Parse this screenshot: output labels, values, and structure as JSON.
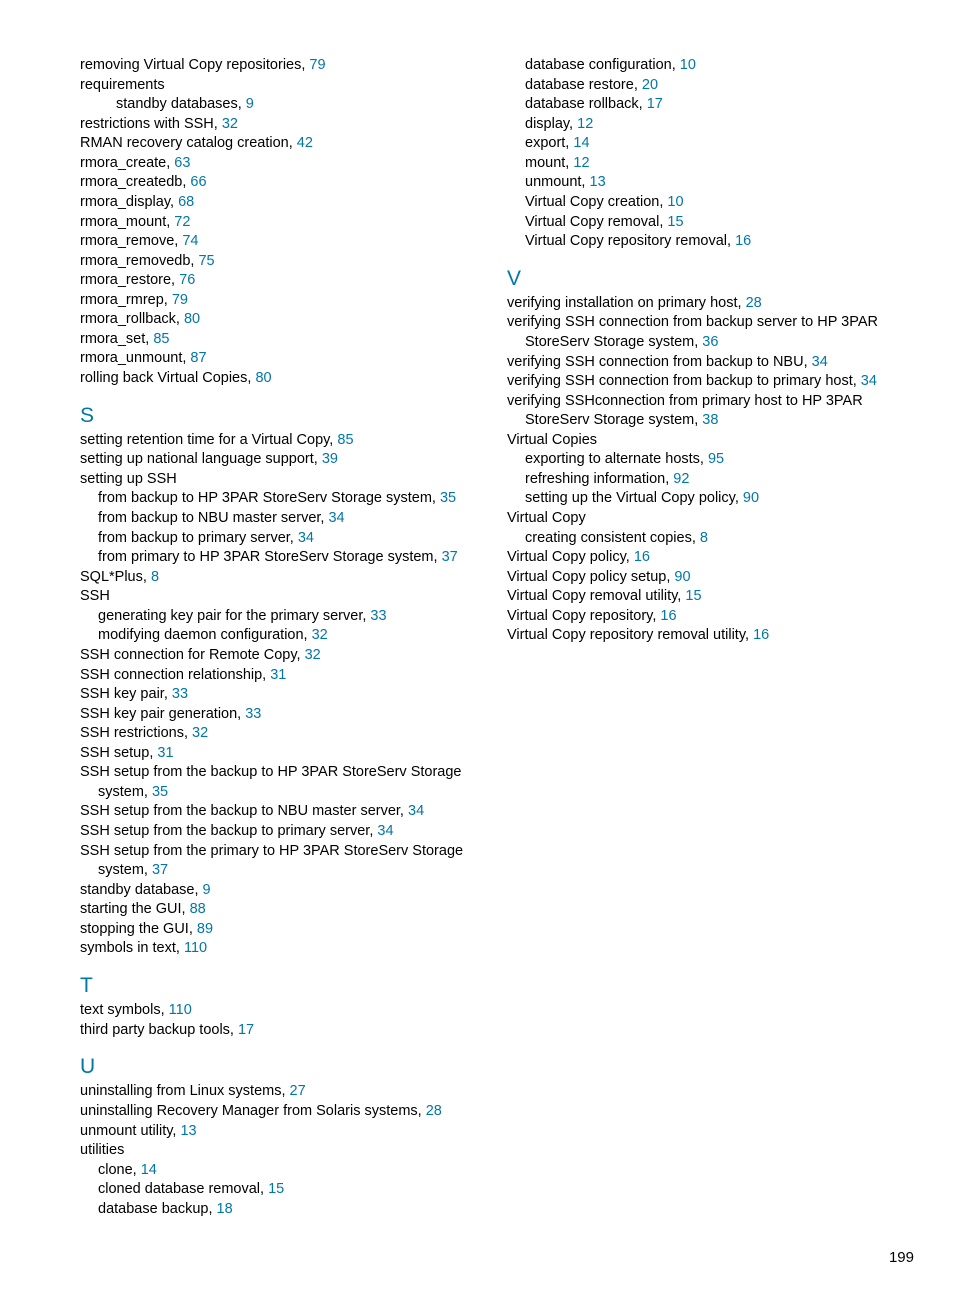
{
  "page_number": "199",
  "left": [
    {
      "t": "e",
      "i": 0,
      "text": "removing Virtual Copy repositories,",
      "pg": "79"
    },
    {
      "t": "e",
      "i": 0,
      "text": "requirements"
    },
    {
      "t": "e",
      "i": 2,
      "text": "standby databases,",
      "pg": "9"
    },
    {
      "t": "e",
      "i": 0,
      "text": "restrictions with SSH,",
      "pg": "32"
    },
    {
      "t": "e",
      "i": 0,
      "text": "RMAN recovery catalog creation,",
      "pg": "42"
    },
    {
      "t": "e",
      "i": 0,
      "text": "rmora_create,",
      "pg": "63"
    },
    {
      "t": "e",
      "i": 0,
      "text": "rmora_createdb,",
      "pg": "66"
    },
    {
      "t": "e",
      "i": 0,
      "text": "rmora_display,",
      "pg": "68"
    },
    {
      "t": "e",
      "i": 0,
      "text": "rmora_mount,",
      "pg": "72"
    },
    {
      "t": "e",
      "i": 0,
      "text": "rmora_remove,",
      "pg": "74"
    },
    {
      "t": "e",
      "i": 0,
      "text": "rmora_removedb,",
      "pg": "75"
    },
    {
      "t": "e",
      "i": 0,
      "text": "rmora_restore,",
      "pg": "76"
    },
    {
      "t": "e",
      "i": 0,
      "text": "rmora_rmrep,",
      "pg": "79"
    },
    {
      "t": "e",
      "i": 0,
      "text": "rmora_rollback,",
      "pg": "80"
    },
    {
      "t": "e",
      "i": 0,
      "text": "rmora_set,",
      "pg": "85"
    },
    {
      "t": "e",
      "i": 0,
      "text": "rmora_unmount,",
      "pg": "87"
    },
    {
      "t": "e",
      "i": 0,
      "text": "rolling back Virtual Copies,",
      "pg": "80"
    },
    {
      "t": "h",
      "text": "S"
    },
    {
      "t": "e",
      "i": 0,
      "text": "setting retention time for a Virtual Copy,",
      "pg": "85"
    },
    {
      "t": "e",
      "i": 0,
      "text": "setting up national language support,",
      "pg": "39"
    },
    {
      "t": "e",
      "i": 0,
      "text": "setting up SSH"
    },
    {
      "t": "e",
      "i": 1,
      "text": "from backup to HP 3PAR StoreServ Storage system,",
      "pg": "35"
    },
    {
      "t": "e",
      "i": 1,
      "text": "from backup to NBU master server,",
      "pg": "34"
    },
    {
      "t": "e",
      "i": 1,
      "text": "from backup to primary server,",
      "pg": "34"
    },
    {
      "t": "e",
      "i": 1,
      "text": "from primary to HP 3PAR StoreServ Storage system,",
      "pg": "37"
    },
    {
      "t": "e",
      "i": 0,
      "text": "SQL*Plus,",
      "pg": "8"
    },
    {
      "t": "e",
      "i": 0,
      "text": "SSH"
    },
    {
      "t": "e",
      "i": 1,
      "text": "generating key pair for the primary server,",
      "pg": "33"
    },
    {
      "t": "e",
      "i": 1,
      "text": "modifying daemon configuration,",
      "pg": "32"
    },
    {
      "t": "e",
      "i": 0,
      "text": "SSH connection for Remote Copy,",
      "pg": "32"
    },
    {
      "t": "e",
      "i": 0,
      "text": "SSH connection relationship,",
      "pg": "31"
    },
    {
      "t": "e",
      "i": 0,
      "text": "SSH key pair,",
      "pg": "33"
    },
    {
      "t": "e",
      "i": 0,
      "text": "SSH key pair generation,",
      "pg": "33"
    },
    {
      "t": "e",
      "i": 0,
      "text": "SSH restrictions,",
      "pg": "32"
    },
    {
      "t": "e",
      "i": 0,
      "text": "SSH setup,",
      "pg": "31"
    },
    {
      "t": "w",
      "i": 0,
      "text": "SSH setup from the backup to HP 3PAR StoreServ Storage system,",
      "pg": "35"
    },
    {
      "t": "e",
      "i": 0,
      "text": "SSH setup from the backup to NBU master server,",
      "pg": "34"
    },
    {
      "t": "e",
      "i": 0,
      "text": "SSH setup from the backup to primary server,",
      "pg": "34"
    },
    {
      "t": "w",
      "i": 0,
      "text": "SSH setup from the primary to HP 3PAR StoreServ Storage system,",
      "pg": "37"
    },
    {
      "t": "e",
      "i": 0,
      "text": "standby database,",
      "pg": "9"
    },
    {
      "t": "e",
      "i": 0,
      "text": "starting the GUI,",
      "pg": "88"
    },
    {
      "t": "e",
      "i": 0,
      "text": "stopping the GUI,",
      "pg": "89"
    },
    {
      "t": "e",
      "i": 0,
      "text": "symbols in text,",
      "pg": "110"
    },
    {
      "t": "h",
      "text": "T"
    },
    {
      "t": "e",
      "i": 0,
      "text": "text symbols,",
      "pg": "110"
    },
    {
      "t": "e",
      "i": 0,
      "text": "third party backup tools,",
      "pg": "17"
    },
    {
      "t": "h",
      "text": "U"
    },
    {
      "t": "e",
      "i": 0,
      "text": "uninstalling from Linux systems,",
      "pg": "27"
    },
    {
      "t": "e",
      "i": 0,
      "text": "uninstalling Recovery Manager from Solaris systems,",
      "pg": "28"
    },
    {
      "t": "e",
      "i": 0,
      "text": "unmount utility,",
      "pg": "13"
    },
    {
      "t": "e",
      "i": 0,
      "text": "utilities"
    },
    {
      "t": "e",
      "i": 1,
      "text": "clone,",
      "pg": "14"
    },
    {
      "t": "e",
      "i": 1,
      "text": "cloned database removal,",
      "pg": "15"
    },
    {
      "t": "e",
      "i": 1,
      "text": "database backup,",
      "pg": "18"
    }
  ],
  "right": [
    {
      "t": "e",
      "i": 1,
      "text": "database configuration,",
      "pg": "10"
    },
    {
      "t": "e",
      "i": 1,
      "text": "database restore,",
      "pg": "20"
    },
    {
      "t": "e",
      "i": 1,
      "text": "database rollback,",
      "pg": "17"
    },
    {
      "t": "e",
      "i": 1,
      "text": "display,",
      "pg": "12"
    },
    {
      "t": "e",
      "i": 1,
      "text": "export,",
      "pg": "14"
    },
    {
      "t": "e",
      "i": 1,
      "text": "mount,",
      "pg": "12"
    },
    {
      "t": "e",
      "i": 1,
      "text": "unmount,",
      "pg": "13"
    },
    {
      "t": "e",
      "i": 1,
      "text": "Virtual Copy creation,",
      "pg": "10"
    },
    {
      "t": "e",
      "i": 1,
      "text": "Virtual Copy removal,",
      "pg": "15"
    },
    {
      "t": "e",
      "i": 1,
      "text": "Virtual Copy repository removal,",
      "pg": "16"
    },
    {
      "t": "h",
      "text": "V"
    },
    {
      "t": "e",
      "i": 0,
      "text": "verifying installation on primary host,",
      "pg": "28"
    },
    {
      "t": "w",
      "i": 0,
      "text": "verifying SSH connection from backup server to HP 3PAR StoreServ Storage system,",
      "pg": "36"
    },
    {
      "t": "e",
      "i": 0,
      "text": "verifying SSH connection from backup to NBU,",
      "pg": "34"
    },
    {
      "t": "e",
      "i": 0,
      "text": "verifying SSH connection from backup to primary host,",
      "pg": "34"
    },
    {
      "t": "w",
      "i": 0,
      "text": "verifying SSHconnection from primary host to HP 3PAR StoreServ Storage system,",
      "pg": "38"
    },
    {
      "t": "e",
      "i": 0,
      "text": "Virtual Copies"
    },
    {
      "t": "e",
      "i": 1,
      "text": "exporting to alternate hosts,",
      "pg": "95"
    },
    {
      "t": "e",
      "i": 1,
      "text": "refreshing information,",
      "pg": "92"
    },
    {
      "t": "e",
      "i": 1,
      "text": "setting up the Virtual Copy policy,",
      "pg": "90"
    },
    {
      "t": "e",
      "i": 0,
      "text": "Virtual Copy"
    },
    {
      "t": "e",
      "i": 1,
      "text": "creating consistent copies,",
      "pg": "8"
    },
    {
      "t": "e",
      "i": 0,
      "text": "Virtual Copy policy,",
      "pg": "16"
    },
    {
      "t": "e",
      "i": 0,
      "text": "Virtual Copy policy setup,",
      "pg": "90"
    },
    {
      "t": "e",
      "i": 0,
      "text": "Virtual Copy removal utility,",
      "pg": "15"
    },
    {
      "t": "e",
      "i": 0,
      "text": "Virtual Copy repository,",
      "pg": "16"
    },
    {
      "t": "e",
      "i": 0,
      "text": "Virtual Copy repository removal utility,",
      "pg": "16"
    }
  ]
}
